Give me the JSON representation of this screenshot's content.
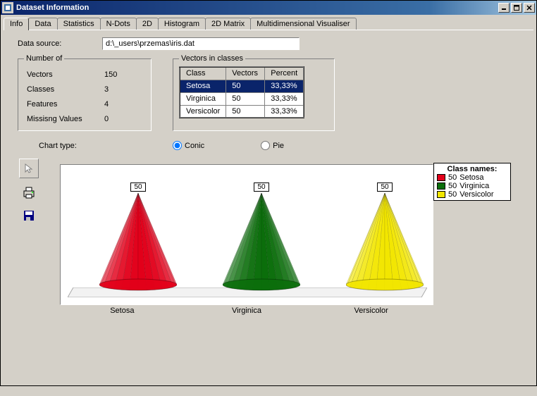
{
  "window": {
    "title": "Dataset Information"
  },
  "tabs": [
    "Info",
    "Data",
    "Statistics",
    "N-Dots",
    "2D",
    "Histogram",
    "2D Matrix",
    "Multidimensional Visualiser"
  ],
  "activeTab": "Info",
  "dataSource": {
    "label": "Data source:",
    "value": "d:\\_users\\przemas\\iris.dat"
  },
  "numberOf": {
    "legend": "Number of",
    "rows": [
      {
        "label": "Vectors",
        "value": "150"
      },
      {
        "label": "Classes",
        "value": "3"
      },
      {
        "label": "Features",
        "value": "4"
      },
      {
        "label": "Missisng Values",
        "value": "0"
      }
    ]
  },
  "vectorsInClasses": {
    "legend": "Vectors in classes",
    "headers": [
      "Class",
      "Vectors",
      "Percent"
    ],
    "rows": [
      {
        "class": "Setosa",
        "vectors": "50",
        "percent": "33,33%",
        "selected": true
      },
      {
        "class": "Virginica",
        "vectors": "50",
        "percent": "33,33%",
        "selected": false
      },
      {
        "class": "Versicolor",
        "vectors": "50",
        "percent": "33,33%",
        "selected": false
      }
    ]
  },
  "chartType": {
    "label": "Chart type:",
    "options": {
      "conic": "Conic",
      "pie": "Pie"
    },
    "selected": "conic"
  },
  "legend": {
    "title": "Class names:",
    "items": [
      {
        "count": "50",
        "name": "Setosa",
        "color": "#e2001a"
      },
      {
        "count": "50",
        "name": "Virginica",
        "color": "#0b6e0b"
      },
      {
        "count": "50",
        "name": "Versicolor",
        "color": "#f2e600"
      }
    ]
  },
  "chart_data": {
    "type": "bar",
    "title": "",
    "categories": [
      "Setosa",
      "Virginica",
      "Versicolor"
    ],
    "values": [
      50,
      50,
      50
    ],
    "colors": [
      "#e2001a",
      "#0b6e0b",
      "#f2e600"
    ],
    "ylim": [
      0,
      50
    ],
    "xlabel": "",
    "ylabel": ""
  }
}
